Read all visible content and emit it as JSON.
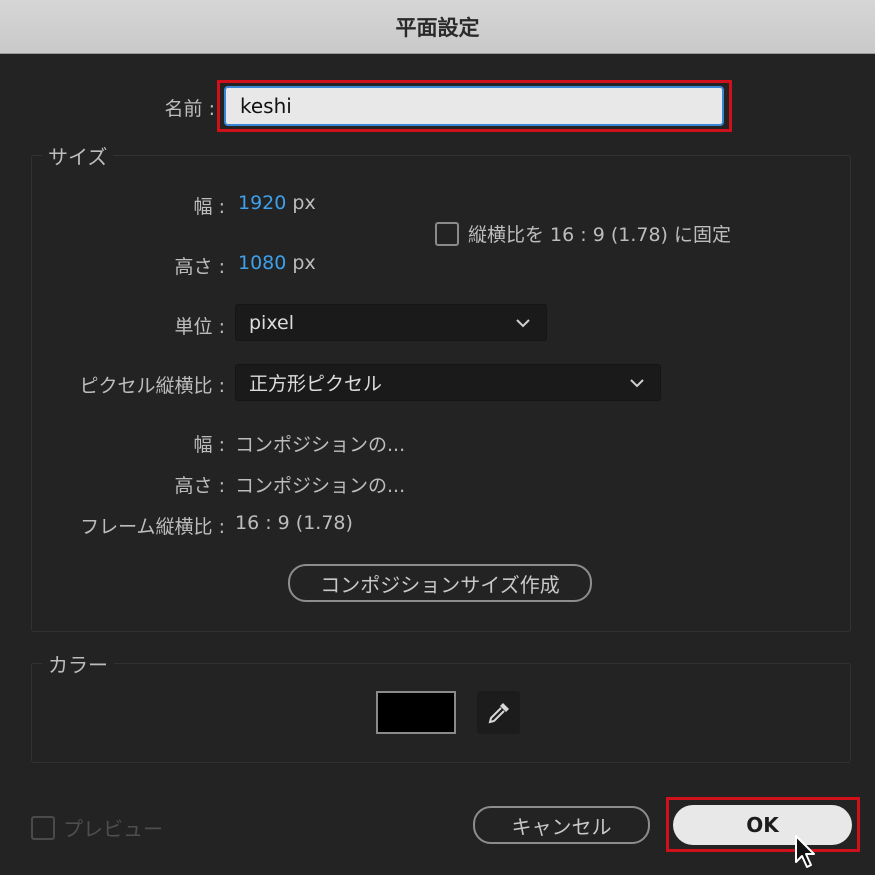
{
  "window": {
    "title": "平面設定"
  },
  "name": {
    "label": "名前 :",
    "value": "keshi"
  },
  "size_group": {
    "title": "サイズ",
    "width_label": "幅 :",
    "width_value": "1920",
    "width_unit": "px",
    "height_label": "高さ :",
    "height_value": "1080",
    "height_unit": "px",
    "lock_aspect_label": "縦横比を 16 : 9 (1.78) に固定",
    "units_label": "単位 :",
    "units_value": "pixel",
    "pixel_aspect_label": "ピクセル縦横比 :",
    "pixel_aspect_value": "正方形ピクセル",
    "info_width_label": "幅 :",
    "info_width_value": "コンポジションの...",
    "info_height_label": "高さ :",
    "info_height_value": "コンポジションの...",
    "frame_aspect_label": "フレーム縦横比 :",
    "frame_aspect_value": "16 : 9 (1.78)",
    "make_comp_size_button": "コンポジションサイズ作成"
  },
  "color_group": {
    "title": "カラー",
    "swatch_color": "#000000"
  },
  "footer": {
    "preview_label": "プレビュー",
    "cancel_button": "キャンセル",
    "ok_button": "OK"
  },
  "colors": {
    "accent_value": "#3ea0ea",
    "highlight": "#d0101a",
    "background": "#232323"
  }
}
